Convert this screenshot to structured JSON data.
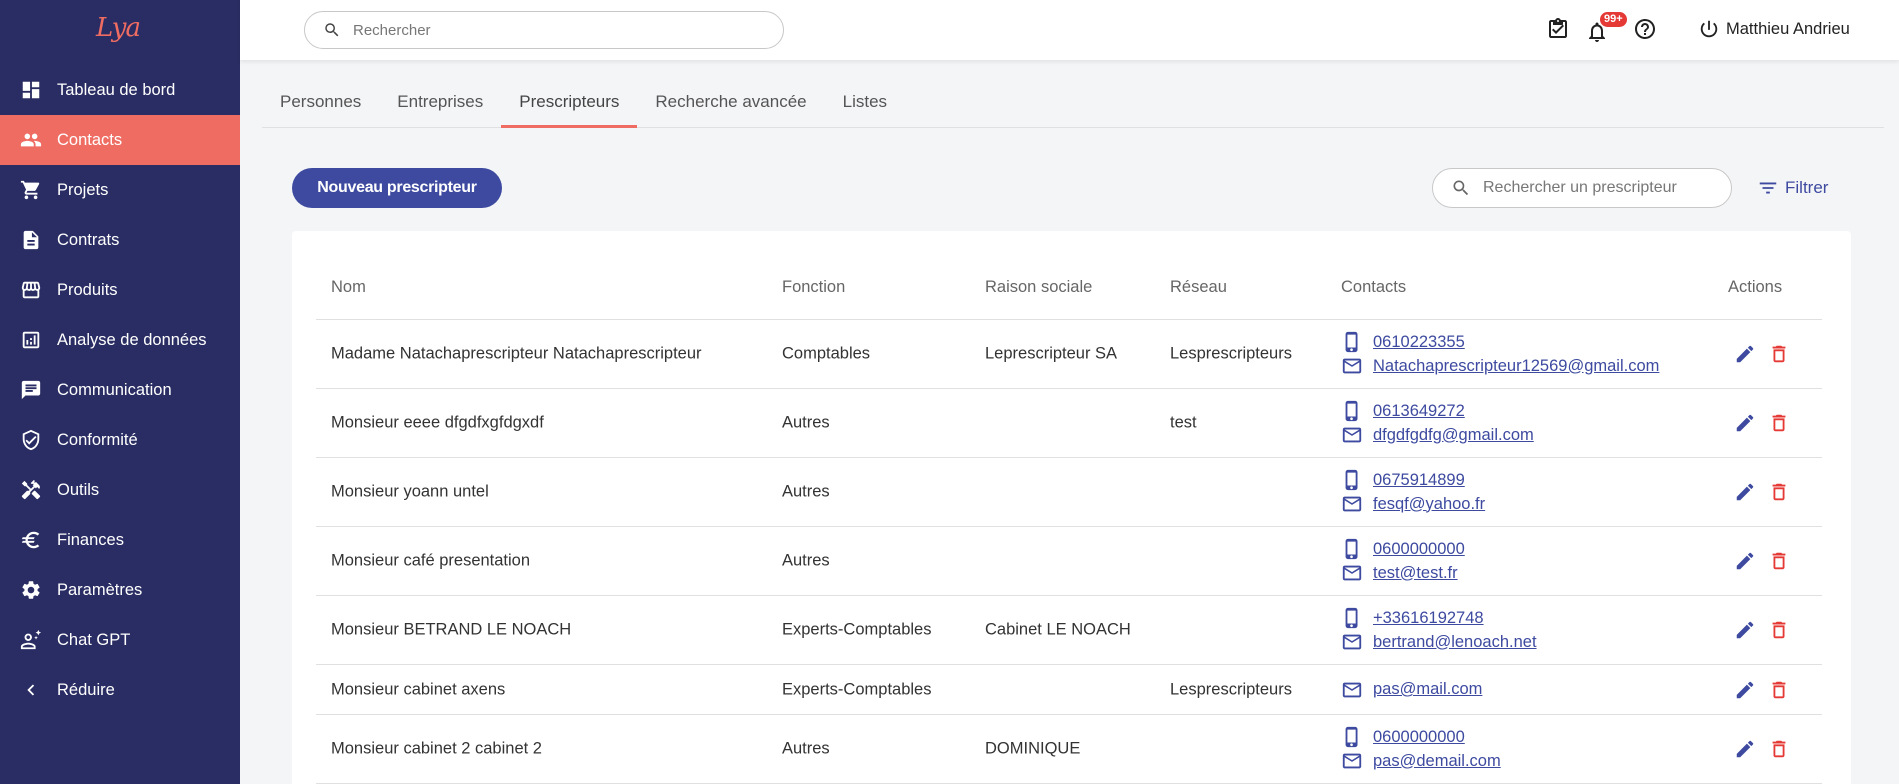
{
  "app": {
    "logo_text": "Lya"
  },
  "sidebar": {
    "items": [
      {
        "label": "Tableau de bord",
        "icon": "dashboard-icon",
        "active": false
      },
      {
        "label": "Contacts",
        "icon": "people-icon",
        "active": true
      },
      {
        "label": "Projets",
        "icon": "cart-icon",
        "active": false
      },
      {
        "label": "Contrats",
        "icon": "document-icon",
        "active": false
      },
      {
        "label": "Produits",
        "icon": "store-icon",
        "active": false
      },
      {
        "label": "Analyse de données",
        "icon": "analytics-icon",
        "active": false
      },
      {
        "label": "Communication",
        "icon": "chat-icon",
        "active": false
      },
      {
        "label": "Conformité",
        "icon": "shield-check-icon",
        "active": false
      },
      {
        "label": "Outils",
        "icon": "tools-icon",
        "active": false
      },
      {
        "label": "Finances",
        "icon": "euro-icon",
        "active": false
      },
      {
        "label": "Paramètres",
        "icon": "gear-icon",
        "active": false
      },
      {
        "label": "Chat GPT",
        "icon": "person-sparkle-icon",
        "active": false
      },
      {
        "label": "Réduire",
        "icon": "chevron-left-icon",
        "active": false
      }
    ]
  },
  "topbar": {
    "search_placeholder": "Rechercher",
    "notification_badge": "99+",
    "user_name": "Matthieu Andrieu"
  },
  "tabs": [
    {
      "label": "Personnes",
      "active": false
    },
    {
      "label": "Entreprises",
      "active": false
    },
    {
      "label": "Prescripteurs",
      "active": true
    },
    {
      "label": "Recherche avancée",
      "active": false
    },
    {
      "label": "Listes",
      "active": false
    }
  ],
  "toolbar": {
    "new_button": "Nouveau prescripteur",
    "search_placeholder": "Rechercher un prescripteur",
    "filter_label": "Filtrer"
  },
  "table": {
    "headers": {
      "nom": "Nom",
      "fonction": "Fonction",
      "raison": "Raison sociale",
      "reseau": "Réseau",
      "contacts": "Contacts",
      "actions": "Actions"
    },
    "rows": [
      {
        "nom": "Madame Natachaprescripteur Natachaprescripteur",
        "fonction": "Comptables",
        "raison": "Leprescripteur SA",
        "reseau": "Lesprescripteurs",
        "phone": "0610223355",
        "email": "Natachaprescripteur12569@gmail.com"
      },
      {
        "nom": "Monsieur eeee dfgdfxgfdgxdf",
        "fonction": "Autres",
        "raison": "",
        "reseau": "test",
        "phone": "0613649272",
        "email": "dfgdfgdfg@gmail.com"
      },
      {
        "nom": "Monsieur yoann untel",
        "fonction": "Autres",
        "raison": "",
        "reseau": "",
        "phone": "0675914899",
        "email": "fesqf@yahoo.fr"
      },
      {
        "nom": "Monsieur café presentation",
        "fonction": "Autres",
        "raison": "",
        "reseau": "",
        "phone": "0600000000",
        "email": "test@test.fr"
      },
      {
        "nom": "Monsieur BETRAND LE NOACH",
        "fonction": "Experts-Comptables",
        "raison": "Cabinet LE NOACH",
        "reseau": "",
        "phone": "+33616192748",
        "email": "bertrand@lenoach.net"
      },
      {
        "nom": "Monsieur cabinet axens",
        "fonction": "Experts-Comptables",
        "raison": "",
        "reseau": "Lesprescripteurs",
        "phone": "",
        "email": "pas@mail.com"
      },
      {
        "nom": "Monsieur cabinet 2 cabinet 2",
        "fonction": "Autres",
        "raison": "DOMINIQUE",
        "reseau": "",
        "phone": "0600000000",
        "email": "pas@demail.com"
      }
    ]
  }
}
